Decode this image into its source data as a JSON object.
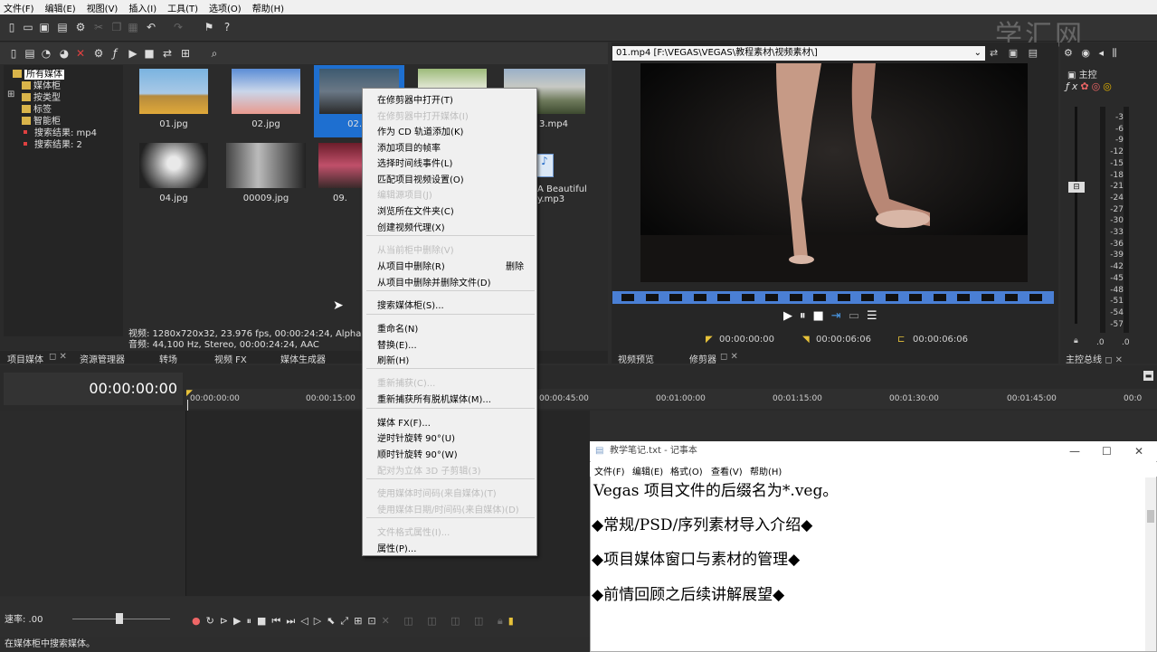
{
  "menubar": [
    "文件(F)",
    "编辑(E)",
    "视图(V)",
    "插入(I)",
    "工具(T)",
    "选项(O)",
    "帮助(H)"
  ],
  "watermark": "学汇网",
  "media_tree": {
    "root": "所有媒体",
    "items": [
      "媒体柜",
      "按类型",
      "标签",
      "智能柜"
    ],
    "searches": [
      "搜索结果: mp4",
      "搜索结果: 2"
    ]
  },
  "thumbnails": [
    "01.jpg",
    "02.jpg",
    "02.mp4",
    "03.mp4",
    "04.jpg",
    "00009.jpg",
    "09.jpg",
    "A Beautiful Day.mp3"
  ],
  "thumb_labels_visible": {
    "t01": "01.jpg",
    "t02": "02.jpg",
    "t03": "02.m",
    "t04": "3.mp4",
    "t05": "04.jpg",
    "t06": "00009.jpg",
    "t07": "09.",
    "t08a": "A Beautiful",
    "t08b": "y.mp3"
  },
  "media_info": {
    "line1": "视频: 1280x720x32, 23.976 fps, 00:00:24:24, Alpha = 无,",
    "line2": "音频: 44,100 Hz, Stereo, 00:00:24:24, AAC"
  },
  "left_tabs": [
    "项目媒体",
    "资源管理器",
    "转场",
    "视频 FX",
    "媒体生成器"
  ],
  "preview": {
    "path": "01.mp4    [F:\\VEGAS\\VEGAS\\教程素材\\视频素材\\]",
    "tc_start": "00:00:00:00",
    "tc_end": "00:00:06:06",
    "tc_length": "00:00:06:06",
    "tabs": [
      "视频预览",
      "修剪器"
    ]
  },
  "master": {
    "title": "主控",
    "tab": "主控总线",
    "scale": [
      "3",
      "6",
      "9",
      "12",
      "15",
      "18",
      "21",
      "24",
      "27",
      "30",
      "33",
      "36",
      "39",
      "42",
      "45",
      "48",
      "51",
      "54",
      "57"
    ],
    "bottom_left": ".0",
    "bottom_right": ".0"
  },
  "timeline": {
    "timecode": "00:00:00:00",
    "ruler": [
      "00:00:00:00",
      "00:00:15:00",
      "00:00:45:00",
      "00:01:00:00",
      "00:01:15:00",
      "00:01:30:00",
      "00:01:45:00",
      "00:0"
    ],
    "rate_label": "速率: .00"
  },
  "statusbar": "在媒体柜中搜索媒体。",
  "context_menu": {
    "items": [
      {
        "label": "在修剪器中打开(T)",
        "disabled": false
      },
      {
        "label": "在修剪器中打开媒体(I)",
        "disabled": true
      },
      {
        "label": "作为 CD 轨道添加(K)",
        "disabled": false
      },
      {
        "label": "添加项目的帧率",
        "disabled": false
      },
      {
        "label": "选择时间线事件(L)",
        "disabled": false
      },
      {
        "label": "匹配项目视频设置(O)",
        "disabled": false
      },
      {
        "label": "编辑源项目(J)",
        "disabled": true
      },
      {
        "label": "浏览所在文件夹(C)",
        "disabled": false
      },
      {
        "label": "创建视频代理(X)",
        "disabled": false
      },
      {
        "label": "从当前柜中删除(V)",
        "disabled": true
      },
      {
        "label": "从项目中删除(R)",
        "disabled": false
      },
      {
        "label": "从项目中删除并删除文件(D)",
        "disabled": false
      },
      {
        "label": "搜索媒体柜(S)...",
        "disabled": false
      },
      {
        "label": "重命名(N)",
        "disabled": false
      },
      {
        "label": "替换(E)...",
        "disabled": false
      },
      {
        "label": "刷新(H)",
        "disabled": false
      },
      {
        "label": "重新捕获(C)...",
        "disabled": true
      },
      {
        "label": "重新捕获所有脱机媒体(M)...",
        "disabled": false
      },
      {
        "label": "媒体 FX(F)...",
        "disabled": false
      },
      {
        "label": "逆时针旋转 90°(U)",
        "disabled": false
      },
      {
        "label": "顺时针旋转 90°(W)",
        "disabled": false
      },
      {
        "label": "配对为立体 3D 子剪辑(3)",
        "disabled": true
      },
      {
        "label": "使用媒体时间码(来自媒体)(T)",
        "disabled": true
      },
      {
        "label": "使用媒体日期/时间码(来自媒体)(D)",
        "disabled": true
      },
      {
        "label": "文件格式属性(I)...",
        "disabled": true
      },
      {
        "label": "属性(P)...",
        "disabled": false
      }
    ],
    "delete_shortcut": "删除"
  },
  "notepad": {
    "title": "教学笔记.txt - 记事本",
    "menu": [
      "文件(F)",
      "编辑(E)",
      "格式(O)",
      "查看(V)",
      "帮助(H)"
    ],
    "lines": [
      "  Vegas 项目文件的后缀名为*.veg。",
      "◆常规/PSD/序列素材导入介绍◆",
      "◆项目媒体窗口与素材的管理◆",
      "◆前情回顾之后续讲解展望◆"
    ]
  },
  "colors": {
    "accent": "#1e6fd0",
    "panel": "#2b2b2b",
    "folder": "#d9b44a",
    "filmstrip": "#4a7fd4"
  }
}
